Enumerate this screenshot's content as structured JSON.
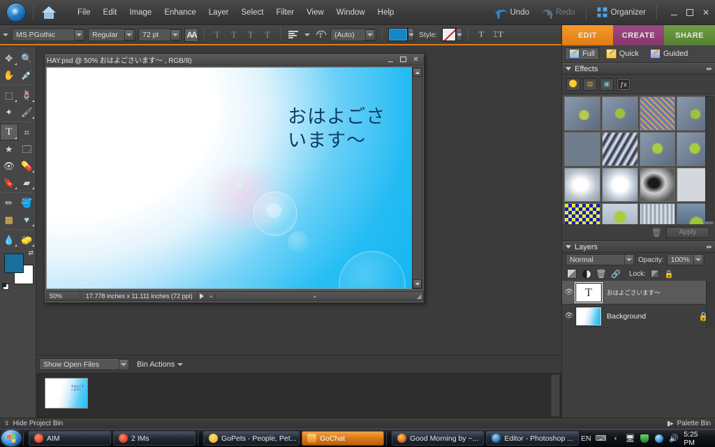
{
  "app": {
    "menus": [
      "File",
      "Edit",
      "Image",
      "Enhance",
      "Layer",
      "Select",
      "Filter",
      "View",
      "Window",
      "Help"
    ],
    "undo_label": "Undo",
    "redo_label": "Redo",
    "organizer_label": "Organizer",
    "window_buttons": {
      "minimize": "–",
      "maximize": "□",
      "close": "✕"
    }
  },
  "options_bar": {
    "font_family": "MS PGothic",
    "font_style": "Regular",
    "font_size": "72 pt",
    "antialias_label": "AA",
    "leading": "(Auto)",
    "color_hex": "#1487c8",
    "style_label": "Style:",
    "faux_bold": "T",
    "faux_italic": "T",
    "underline": "T",
    "strikethrough": "T"
  },
  "toolbox": {
    "tools": [
      {
        "name": "move-tool",
        "glyph": "➤"
      },
      {
        "name": "zoom-tool",
        "glyph": "🔍"
      },
      {
        "name": "hand-tool",
        "glyph": "✋"
      },
      {
        "name": "eyedropper-tool",
        "glyph": "✒"
      },
      {
        "name": "marquee-tool",
        "glyph": "⬚"
      },
      {
        "name": "lasso-tool",
        "glyph": "ʃ"
      },
      {
        "name": "magic-wand-tool",
        "glyph": "✦"
      },
      {
        "name": "selection-brush-tool",
        "glyph": "✹"
      },
      {
        "name": "type-tool",
        "glyph": "T"
      },
      {
        "name": "crop-tool",
        "glyph": "⌗"
      },
      {
        "name": "cookie-cutter-tool",
        "glyph": "☆"
      },
      {
        "name": "straighten-tool",
        "glyph": "◰"
      },
      {
        "name": "red-eye-tool",
        "glyph": "◉"
      },
      {
        "name": "healing-brush-tool",
        "glyph": "✎"
      },
      {
        "name": "clone-stamp-tool",
        "glyph": "⚑"
      },
      {
        "name": "eraser-tool",
        "glyph": "▱"
      },
      {
        "name": "pencil-tool",
        "glyph": "✐"
      },
      {
        "name": "paint-bucket-tool",
        "glyph": "◢"
      },
      {
        "name": "gradient-tool",
        "glyph": "▧"
      },
      {
        "name": "shape-tool",
        "glyph": "♥"
      },
      {
        "name": "blur-tool",
        "glyph": "💧"
      },
      {
        "name": "sponge-tool",
        "glyph": "◖"
      }
    ],
    "selected_tool": "type-tool",
    "foreground_color": "#1a6e9e",
    "background_color": "#ffffff"
  },
  "document": {
    "title": "HAY.psd @ 50% おはよごさいます～ , RGB/8)",
    "canvas_text_line1": "おはよごさ",
    "canvas_text_line2": "います～",
    "zoom": "50%",
    "dimensions": "17.778 inches x 11.111 inches (72 ppi)"
  },
  "project_bin": {
    "filter_label": "Show Open Files",
    "actions_label": "Bin Actions",
    "hide_label": "Hide Project Bin",
    "palette_bin_label": "Palette Bin"
  },
  "right_panel": {
    "modes": [
      {
        "label": "EDIT",
        "color": "#e07b14"
      },
      {
        "label": "CREATE",
        "color": "#86376c"
      },
      {
        "label": "SHARE",
        "color": "#558032"
      }
    ],
    "edit_tabs": [
      {
        "label": "Full",
        "active": true
      },
      {
        "label": "Quick",
        "active": false
      },
      {
        "label": "Guided",
        "active": false
      }
    ],
    "effects": {
      "title": "Effects",
      "categories": [
        "filters-icon",
        "layer-styles-icon",
        "photo-effects-icon",
        "show-all-icon"
      ],
      "selected_category": 3,
      "apply_label": "Apply",
      "thumbnails": [
        "#7e8ea0",
        "#7e8ea0",
        "#9b8fb0",
        "#7e8ea0",
        "#6f7d8c",
        "#8a93a8",
        "#7e8ea0",
        "#7e8ea0",
        "#c9cfd8",
        "#d6dbe4",
        "#8d8d8d",
        "#cfcfcf",
        "#2a3fa8",
        "#9aa9b8",
        "#b9c3cf",
        "#6d8fa8"
      ]
    },
    "layers": {
      "title": "Layers",
      "blend_mode": "Normal",
      "opacity_label": "Opacity:",
      "opacity_value": "100%",
      "lock_label": "Lock:",
      "items": [
        {
          "name": "おはよごさいます～",
          "type": "text",
          "visible": true,
          "selected": true,
          "locked": false
        },
        {
          "name": "Background",
          "type": "background",
          "visible": true,
          "selected": false,
          "locked": true
        }
      ]
    }
  },
  "taskbar": {
    "items": [
      {
        "label": "AIM",
        "icon": "aim-icon",
        "active": false
      },
      {
        "label": "2 IMs",
        "icon": "im-icon",
        "active": false
      },
      {
        "label": "GoPets - People, Pet...",
        "icon": "gopets-icon",
        "active": false
      },
      {
        "label": "GoChat",
        "icon": "gochat-icon",
        "active": true
      },
      {
        "label": "Good Morning by ~...",
        "icon": "firefox-icon",
        "active": false
      },
      {
        "label": "Editor - Photoshop ...",
        "icon": "photoshop-icon",
        "active": false
      }
    ],
    "language": "EN",
    "clock": "5:25 PM"
  }
}
